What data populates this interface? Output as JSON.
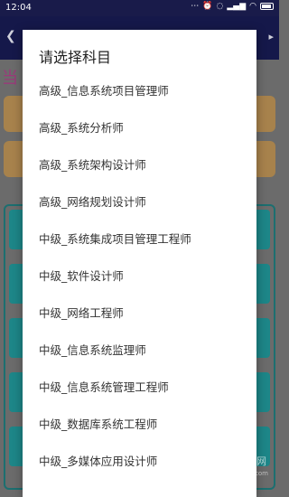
{
  "status_bar": {
    "time": "12:04",
    "icons": [
      "dots-icon",
      "alarm-icon",
      "mute-icon",
      "signal-icon",
      "wifi-icon",
      "battery-icon"
    ]
  },
  "background": {
    "current_label_fragment": "当"
  },
  "dialog": {
    "title": "请选择科目",
    "options": [
      "高级_信息系统项目管理师",
      "高级_系统分析师",
      "高级_系统架构设计师",
      "高级_网络规划设计师",
      "中级_系统集成项目管理工程师",
      "中级_软件设计师",
      "中级_网络工程师",
      "中级_信息系统监理师",
      "中级_信息系统管理工程师",
      "中级_数据库系统工程师",
      "中级_多媒体应用设计师"
    ]
  },
  "watermark": {
    "brand": "2265",
    "name": "手游网",
    "url": "2265.com"
  },
  "colors": {
    "status_bar": "#191b4a",
    "app_bar": "#15184a",
    "card": "#a7824c",
    "tile": "#1d8688",
    "dialog_bg": "#ffffff"
  }
}
